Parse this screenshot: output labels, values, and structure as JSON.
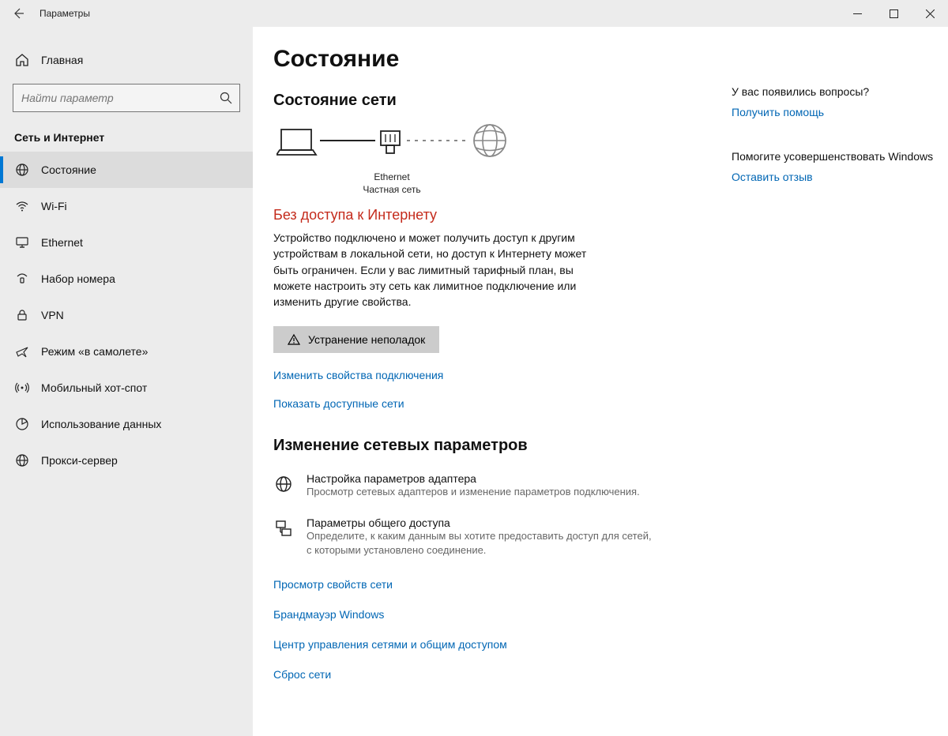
{
  "window": {
    "title": "Параметры"
  },
  "sidebar": {
    "home_label": "Главная",
    "search_placeholder": "Найти параметр",
    "category": "Сеть и Интернет",
    "items": [
      {
        "label": "Состояние"
      },
      {
        "label": "Wi-Fi"
      },
      {
        "label": "Ethernet"
      },
      {
        "label": "Набор номера"
      },
      {
        "label": "VPN"
      },
      {
        "label": "Режим «в самолете»"
      },
      {
        "label": "Мобильный хот-спот"
      },
      {
        "label": "Использование данных"
      },
      {
        "label": "Прокси-сервер"
      }
    ]
  },
  "main": {
    "page_title": "Состояние",
    "net_status_heading": "Состояние сети",
    "diagram": {
      "adapter": "Ethernet",
      "network_type": "Частная сеть"
    },
    "no_internet_title": "Без доступа к Интернету",
    "no_internet_body": "Устройство подключено и может получить доступ к другим устройствам в локальной сети, но доступ к Интернету может быть ограничен. Если у вас лимитный тарифный план, вы можете настроить эту сеть как лимитное подключение или изменить другие свойства.",
    "troubleshoot_label": "Устранение неполадок",
    "change_props_link": "Изменить свойства подключения",
    "show_networks_link": "Показать доступные сети",
    "change_settings_heading": "Изменение сетевых параметров",
    "adapter_opt_title": "Настройка параметров адаптера",
    "adapter_opt_desc": "Просмотр сетевых адаптеров и изменение параметров подключения.",
    "sharing_opt_title": "Параметры общего доступа",
    "sharing_opt_desc": "Определите, к каким данным вы хотите предоставить доступ для сетей, с которыми установлено соединение.",
    "view_props_link": "Просмотр свойств сети",
    "firewall_link": "Брандмауэр Windows",
    "sharing_center_link": "Центр управления сетями и общим доступом",
    "reset_link": "Сброс сети"
  },
  "right": {
    "questions": "У вас появились вопросы?",
    "get_help": "Получить помощь",
    "improve": "Помогите усовершенствовать Windows",
    "feedback": "Оставить отзыв"
  }
}
